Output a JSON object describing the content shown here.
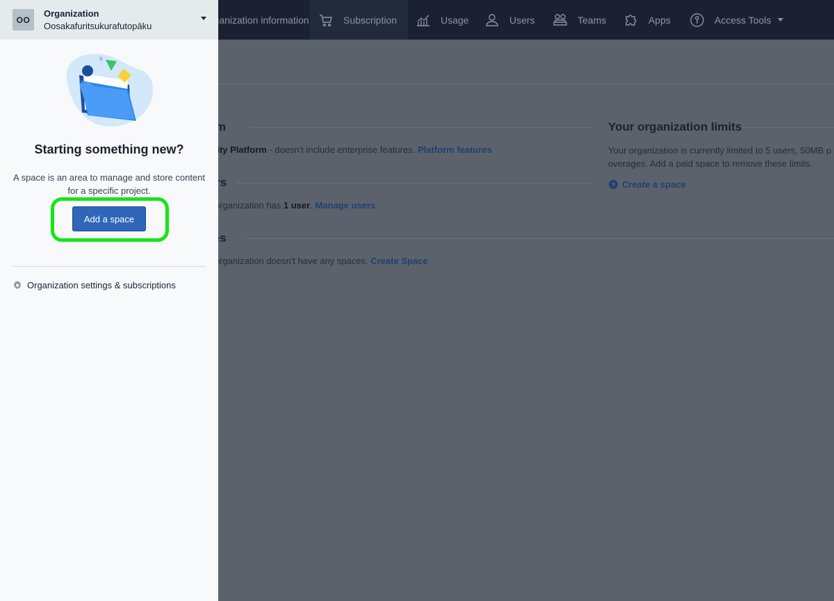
{
  "topnav": {
    "items": [
      {
        "label": "Organization information",
        "icon": "building-icon"
      },
      {
        "label": "Subscription",
        "icon": "cart-icon"
      },
      {
        "label": "Usage",
        "icon": "chart-icon"
      },
      {
        "label": "Users",
        "icon": "user-icon"
      },
      {
        "label": "Teams",
        "icon": "team-icon"
      },
      {
        "label": "Apps",
        "icon": "puzzle-icon"
      },
      {
        "label": "Access Tools",
        "icon": "key-icon"
      }
    ]
  },
  "main": {
    "platform": {
      "title": "Platform",
      "name": "Community Platform",
      "desc": " - doesn't include enterprise features. ",
      "link": "Platform features"
    },
    "users": {
      "title": "Users",
      "prefix": "Your organization has ",
      "count": "1 user",
      "suffix": ". ",
      "link": "Manage users"
    },
    "spaces": {
      "title": "Spaces",
      "text": "Your organization doesn't have any spaces. ",
      "link": "Create Space"
    },
    "limits": {
      "title": "Your organization limits",
      "line1": "Your organization is currently limited to 5 users, 50MB p",
      "line2": "overages. Add a paid space to remove these limits.",
      "link": "Create a space"
    }
  },
  "panel": {
    "avatar": "OO",
    "org_label": "Organization",
    "org_name": "Oosakafuritsukurafutopāku",
    "headline": "Starting something new?",
    "description": "A space is an area to manage and store content for a specific project.",
    "add_button": "Add a space",
    "settings_link": "Organization settings & subscriptions"
  },
  "colors": {
    "accent": "#2e66b8",
    "highlight": "#14e614",
    "nav_bg": "#1b2130",
    "overlay": "#5b626c"
  }
}
